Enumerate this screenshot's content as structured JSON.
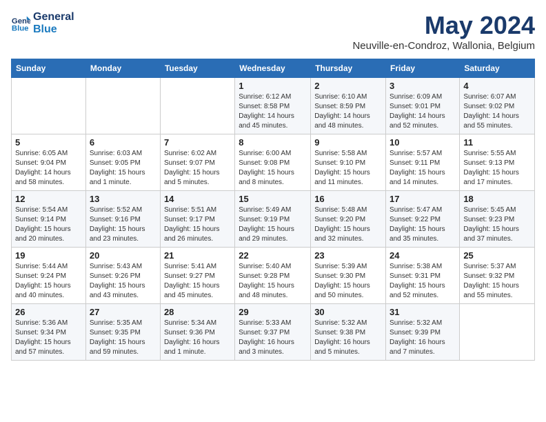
{
  "logo": {
    "line1": "General",
    "line2": "Blue"
  },
  "title": "May 2024",
  "location": "Neuville-en-Condroz, Wallonia, Belgium",
  "days_of_week": [
    "Sunday",
    "Monday",
    "Tuesday",
    "Wednesday",
    "Thursday",
    "Friday",
    "Saturday"
  ],
  "weeks": [
    [
      {
        "day": null
      },
      {
        "day": null
      },
      {
        "day": null
      },
      {
        "day": "1",
        "sunrise": "6:12 AM",
        "sunset": "8:58 PM",
        "daylight": "14 hours and 45 minutes."
      },
      {
        "day": "2",
        "sunrise": "6:10 AM",
        "sunset": "8:59 PM",
        "daylight": "14 hours and 48 minutes."
      },
      {
        "day": "3",
        "sunrise": "6:09 AM",
        "sunset": "9:01 PM",
        "daylight": "14 hours and 52 minutes."
      },
      {
        "day": "4",
        "sunrise": "6:07 AM",
        "sunset": "9:02 PM",
        "daylight": "14 hours and 55 minutes."
      }
    ],
    [
      {
        "day": "5",
        "sunrise": "6:05 AM",
        "sunset": "9:04 PM",
        "daylight": "14 hours and 58 minutes."
      },
      {
        "day": "6",
        "sunrise": "6:03 AM",
        "sunset": "9:05 PM",
        "daylight": "15 hours and 1 minute."
      },
      {
        "day": "7",
        "sunrise": "6:02 AM",
        "sunset": "9:07 PM",
        "daylight": "15 hours and 5 minutes."
      },
      {
        "day": "8",
        "sunrise": "6:00 AM",
        "sunset": "9:08 PM",
        "daylight": "15 hours and 8 minutes."
      },
      {
        "day": "9",
        "sunrise": "5:58 AM",
        "sunset": "9:10 PM",
        "daylight": "15 hours and 11 minutes."
      },
      {
        "day": "10",
        "sunrise": "5:57 AM",
        "sunset": "9:11 PM",
        "daylight": "15 hours and 14 minutes."
      },
      {
        "day": "11",
        "sunrise": "5:55 AM",
        "sunset": "9:13 PM",
        "daylight": "15 hours and 17 minutes."
      }
    ],
    [
      {
        "day": "12",
        "sunrise": "5:54 AM",
        "sunset": "9:14 PM",
        "daylight": "15 hours and 20 minutes."
      },
      {
        "day": "13",
        "sunrise": "5:52 AM",
        "sunset": "9:16 PM",
        "daylight": "15 hours and 23 minutes."
      },
      {
        "day": "14",
        "sunrise": "5:51 AM",
        "sunset": "9:17 PM",
        "daylight": "15 hours and 26 minutes."
      },
      {
        "day": "15",
        "sunrise": "5:49 AM",
        "sunset": "9:19 PM",
        "daylight": "15 hours and 29 minutes."
      },
      {
        "day": "16",
        "sunrise": "5:48 AM",
        "sunset": "9:20 PM",
        "daylight": "15 hours and 32 minutes."
      },
      {
        "day": "17",
        "sunrise": "5:47 AM",
        "sunset": "9:22 PM",
        "daylight": "15 hours and 35 minutes."
      },
      {
        "day": "18",
        "sunrise": "5:45 AM",
        "sunset": "9:23 PM",
        "daylight": "15 hours and 37 minutes."
      }
    ],
    [
      {
        "day": "19",
        "sunrise": "5:44 AM",
        "sunset": "9:24 PM",
        "daylight": "15 hours and 40 minutes."
      },
      {
        "day": "20",
        "sunrise": "5:43 AM",
        "sunset": "9:26 PM",
        "daylight": "15 hours and 43 minutes."
      },
      {
        "day": "21",
        "sunrise": "5:41 AM",
        "sunset": "9:27 PM",
        "daylight": "15 hours and 45 minutes."
      },
      {
        "day": "22",
        "sunrise": "5:40 AM",
        "sunset": "9:28 PM",
        "daylight": "15 hours and 48 minutes."
      },
      {
        "day": "23",
        "sunrise": "5:39 AM",
        "sunset": "9:30 PM",
        "daylight": "15 hours and 50 minutes."
      },
      {
        "day": "24",
        "sunrise": "5:38 AM",
        "sunset": "9:31 PM",
        "daylight": "15 hours and 52 minutes."
      },
      {
        "day": "25",
        "sunrise": "5:37 AM",
        "sunset": "9:32 PM",
        "daylight": "15 hours and 55 minutes."
      }
    ],
    [
      {
        "day": "26",
        "sunrise": "5:36 AM",
        "sunset": "9:34 PM",
        "daylight": "15 hours and 57 minutes."
      },
      {
        "day": "27",
        "sunrise": "5:35 AM",
        "sunset": "9:35 PM",
        "daylight": "15 hours and 59 minutes."
      },
      {
        "day": "28",
        "sunrise": "5:34 AM",
        "sunset": "9:36 PM",
        "daylight": "16 hours and 1 minute."
      },
      {
        "day": "29",
        "sunrise": "5:33 AM",
        "sunset": "9:37 PM",
        "daylight": "16 hours and 3 minutes."
      },
      {
        "day": "30",
        "sunrise": "5:32 AM",
        "sunset": "9:38 PM",
        "daylight": "16 hours and 5 minutes."
      },
      {
        "day": "31",
        "sunrise": "5:32 AM",
        "sunset": "9:39 PM",
        "daylight": "16 hours and 7 minutes."
      },
      {
        "day": null
      }
    ]
  ]
}
